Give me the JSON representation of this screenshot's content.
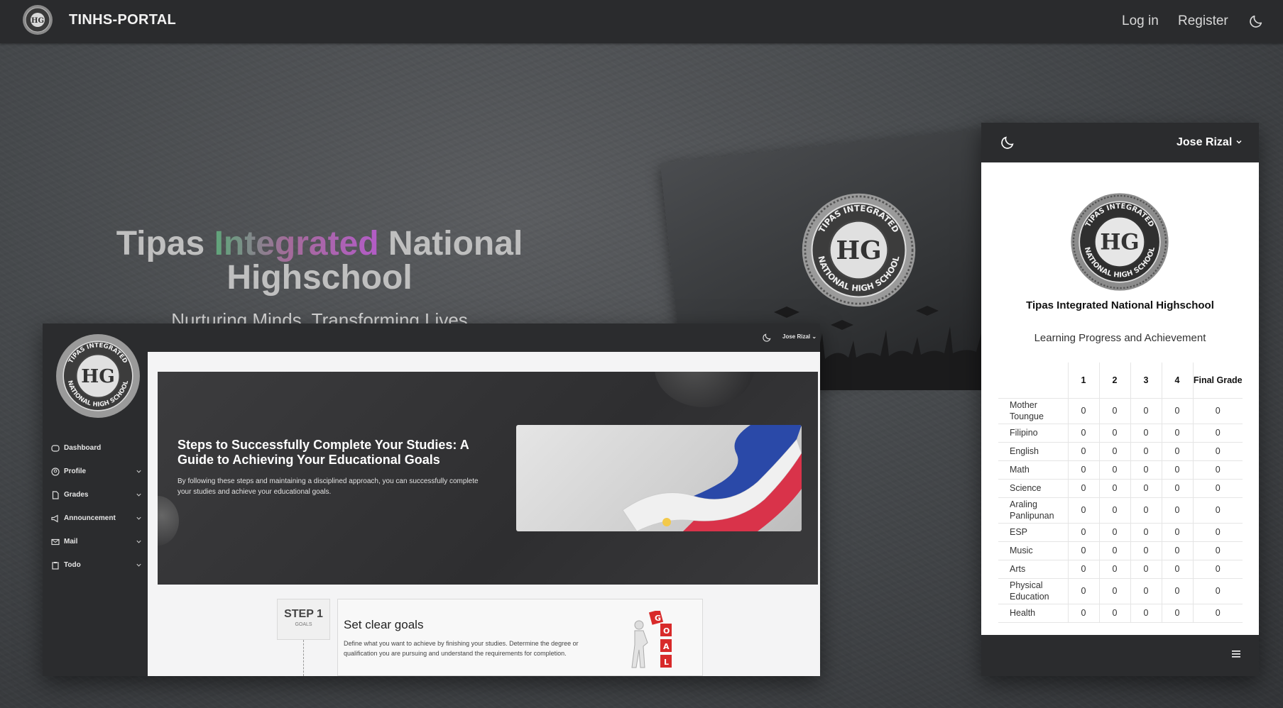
{
  "navbar": {
    "brand": "TINHS-PORTAL",
    "login": "Log in",
    "register": "Register",
    "theme_icon": "moon-icon"
  },
  "hero": {
    "title_part1": "Tipas ",
    "title_part2": "Integrated",
    "title_part3": " National",
    "title_line2": "Highschool",
    "subtitle": "Nurturing Minds, Transforming Lives"
  },
  "seal_text": {
    "top": "TIPAS INTEGRATED",
    "bottom": "NATIONAL HIGH SCHOOL"
  },
  "dashboard": {
    "user": "Jose Rizal",
    "menu": [
      {
        "label": "Dashboard",
        "icon": "dashboard-icon",
        "expandable": false
      },
      {
        "label": "Profile",
        "icon": "user-icon",
        "expandable": true
      },
      {
        "label": "Grades",
        "icon": "document-icon",
        "expandable": true
      },
      {
        "label": "Announcement",
        "icon": "megaphone-icon",
        "expandable": true
      },
      {
        "label": "Mail",
        "icon": "mail-icon",
        "expandable": true
      },
      {
        "label": "Todo",
        "icon": "clipboard-icon",
        "expandable": true
      }
    ],
    "banner_title": "Steps to Successfully Complete Your Studies: A Guide to Achieving Your Educational Goals",
    "banner_text": "By following these steps and maintaining a disciplined approach, you can successfully complete your studies and achieve your educational goals.",
    "step_number": "STEP 1",
    "step_label": "GOALS",
    "step_title": "Set clear goals",
    "step_text": "Define what you want to achieve by finishing your studies. Determine the degree or qualification you are pursuing and understand the requirements for completion.",
    "goal_letters": [
      "G",
      "O",
      "A",
      "L"
    ]
  },
  "grades_panel": {
    "user": "Jose Rizal",
    "school_name": "Tipas Integrated National Highschool",
    "subtitle": "Learning Progress and Achievement",
    "headers": [
      "",
      "1",
      "2",
      "3",
      "4",
      "Final Grade"
    ],
    "rows": [
      {
        "subject": "Mother Tounguе",
        "q": [
          "0",
          "0",
          "0",
          "0",
          "0"
        ]
      },
      {
        "subject": "Filipino",
        "q": [
          "0",
          "0",
          "0",
          "0",
          "0"
        ]
      },
      {
        "subject": "English",
        "q": [
          "0",
          "0",
          "0",
          "0",
          "0"
        ]
      },
      {
        "subject": "Math",
        "q": [
          "0",
          "0",
          "0",
          "0",
          "0"
        ]
      },
      {
        "subject": "Science",
        "q": [
          "0",
          "0",
          "0",
          "0",
          "0"
        ]
      },
      {
        "subject": "Araling Panlipunan",
        "q": [
          "0",
          "0",
          "0",
          "0",
          "0"
        ]
      },
      {
        "subject": "ESP",
        "q": [
          "0",
          "0",
          "0",
          "0",
          "0"
        ]
      },
      {
        "subject": "Music",
        "q": [
          "0",
          "0",
          "0",
          "0",
          "0"
        ]
      },
      {
        "subject": "Arts",
        "q": [
          "0",
          "0",
          "0",
          "0",
          "0"
        ]
      },
      {
        "subject": "Physical Education",
        "q": [
          "0",
          "0",
          "0",
          "0",
          "0"
        ]
      },
      {
        "subject": "Health",
        "q": [
          "0",
          "0",
          "0",
          "0",
          "0"
        ]
      }
    ],
    "menu_icon": "hamburger-icon"
  }
}
